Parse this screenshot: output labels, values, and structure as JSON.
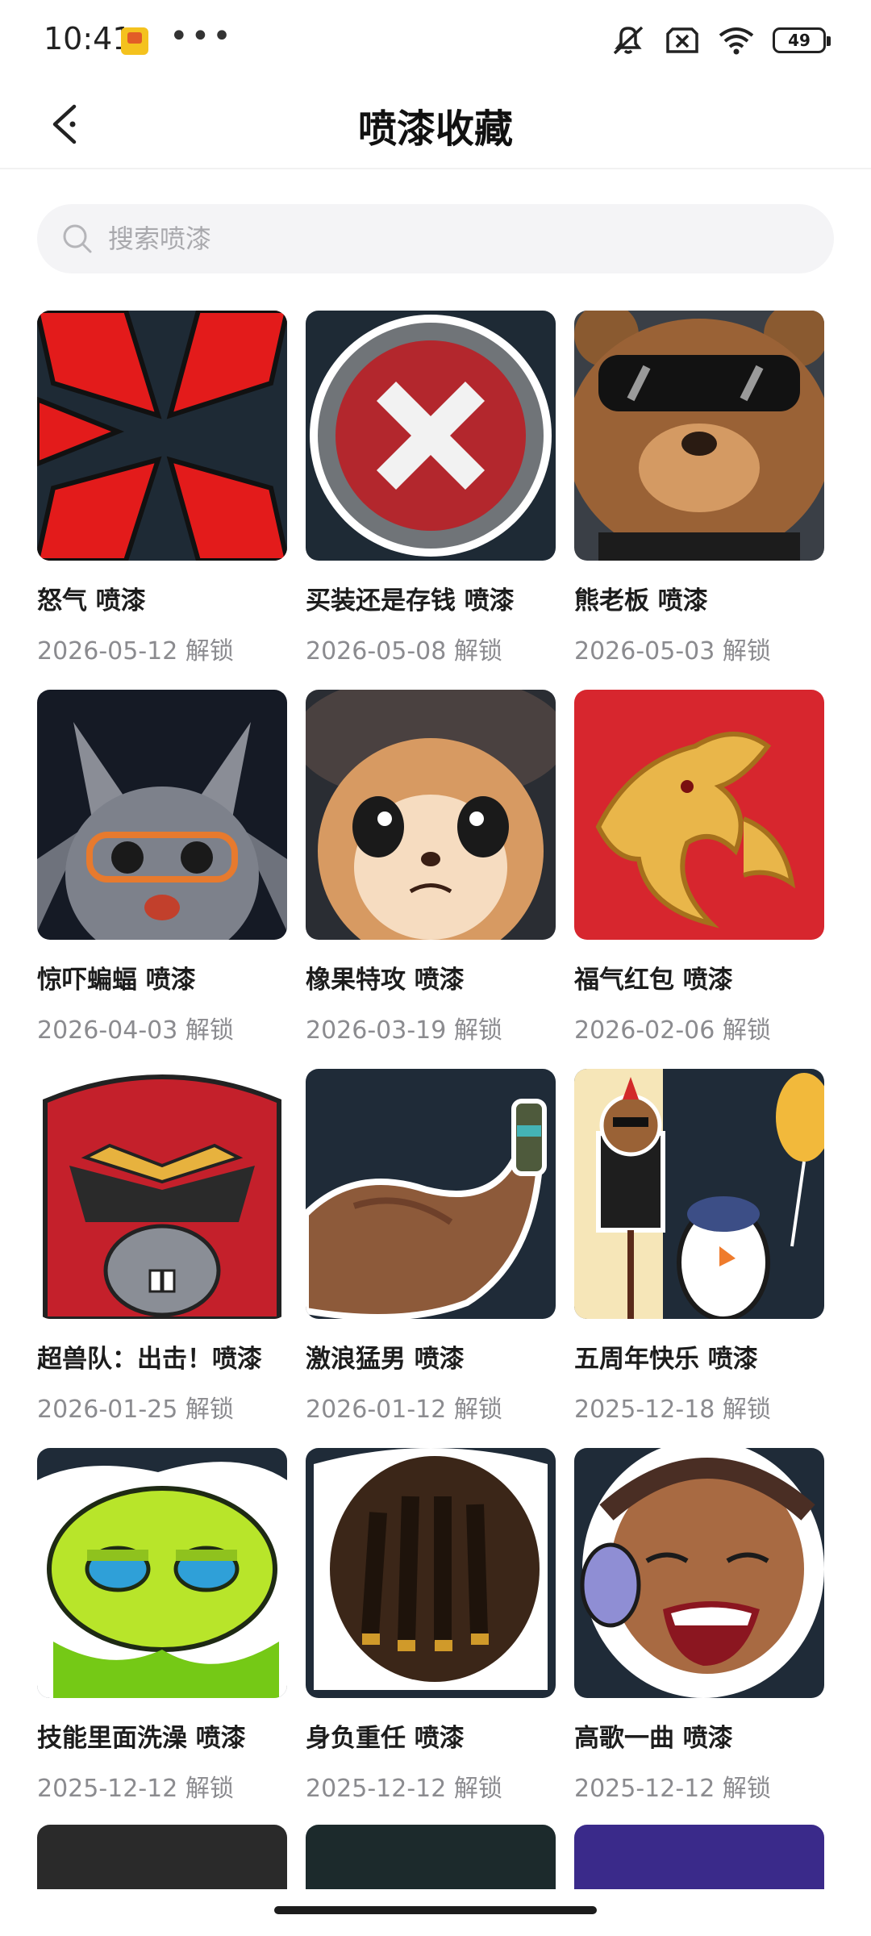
{
  "status": {
    "time": "10:41",
    "battery": "49"
  },
  "header": {
    "title": "喷漆收藏"
  },
  "search": {
    "placeholder": "搜索喷漆"
  },
  "sprays": [
    {
      "name": "怒气 喷漆",
      "date": "2026-05-12 解锁",
      "art": "rage-burst"
    },
    {
      "name": "买装还是存钱 喷漆",
      "date": "2026-05-08 解锁",
      "art": "red-cross-button"
    },
    {
      "name": "熊老板 喷漆",
      "date": "2026-05-03 解锁",
      "art": "bear-boss"
    },
    {
      "name": "惊吓蝙蝠 喷漆",
      "date": "2026-04-03 解锁",
      "art": "scared-bat"
    },
    {
      "name": "橡果特攻 喷漆",
      "date": "2026-03-19 解锁",
      "art": "acorn-squirrel"
    },
    {
      "name": "福气红包 喷漆",
      "date": "2026-02-06 解锁",
      "art": "golden-dragon"
    },
    {
      "name": "超兽队：出击！喷漆",
      "date": "2026-01-25 解锁",
      "art": "armored-hero"
    },
    {
      "name": "激浪猛男 喷漆",
      "date": "2026-01-12 解锁",
      "art": "muscle-arm"
    },
    {
      "name": "五周年快乐 喷漆",
      "date": "2025-12-18 解锁",
      "art": "anniversary-party"
    },
    {
      "name": "技能里面洗澡 喷漆",
      "date": "2025-12-12 解锁",
      "art": "green-slime"
    },
    {
      "name": "身负重任 喷漆",
      "date": "2025-12-12 解锁",
      "art": "dreadlocks-agent"
    },
    {
      "name": "高歌一曲 喷漆",
      "date": "2025-12-12 解锁",
      "art": "singing-headphones"
    }
  ]
}
